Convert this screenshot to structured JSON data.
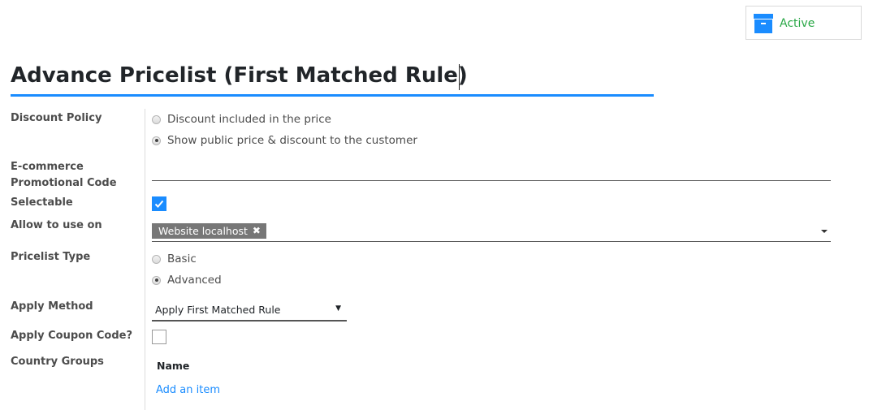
{
  "header": {
    "active_button": {
      "label": "Active",
      "icon": "archive-icon"
    }
  },
  "form": {
    "title": "Advance Pricelist (First Matched Rule)",
    "discount_policy": {
      "label": "Discount Policy",
      "options": [
        {
          "label": "Discount included in the price",
          "checked": false
        },
        {
          "label": "Show public price & discount to the customer",
          "checked": true
        }
      ]
    },
    "promo_code": {
      "label_line1": "E-commerce",
      "label_line2": "Promotional Code",
      "value": ""
    },
    "selectable": {
      "label": "Selectable",
      "checked": true
    },
    "allow_to_use_on": {
      "label": "Allow to use on",
      "tags": [
        "Website localhost"
      ],
      "remove_glyph": "✖"
    },
    "pricelist_type": {
      "label": "Pricelist Type",
      "options": [
        {
          "label": "Basic",
          "checked": false
        },
        {
          "label": "Advanced",
          "checked": true
        }
      ]
    },
    "apply_method": {
      "label": "Apply Method",
      "value": "Apply First Matched Rule",
      "arrow": "▼"
    },
    "apply_coupon": {
      "label": "Apply Coupon Code?",
      "checked": false
    },
    "country_groups": {
      "label": "Country Groups",
      "column_header": "Name",
      "add_link": "Add an item"
    }
  },
  "colors": {
    "accent": "#1a8cff",
    "active_green": "#28a745",
    "tag_bg": "#777777"
  }
}
